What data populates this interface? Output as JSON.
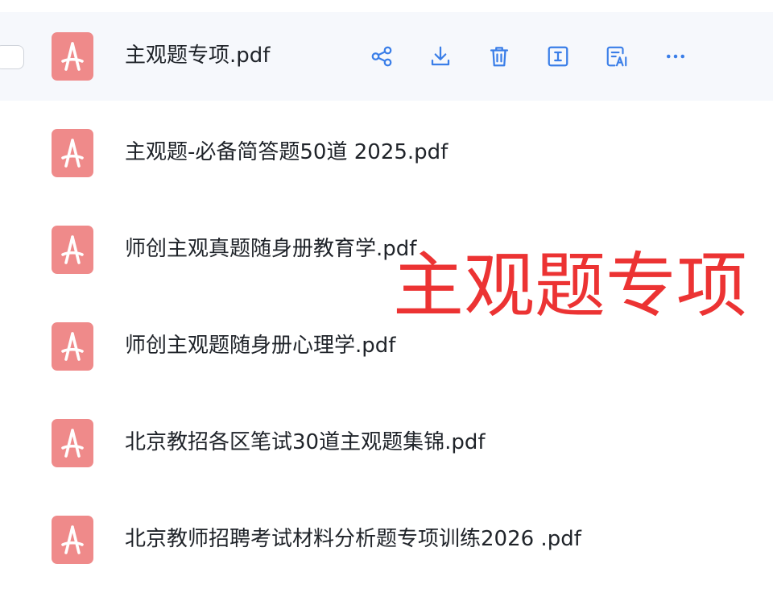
{
  "files": [
    {
      "name": "主观题专项.pdf"
    },
    {
      "name": "主观题-必备简答题50道 2025.pdf"
    },
    {
      "name": "师创主观真题随身册教育学.pdf"
    },
    {
      "name": "师创主观题随身册心理学.pdf"
    },
    {
      "name": "北京教招各区笔试30道主观题集锦.pdf"
    },
    {
      "name": "北京教师招聘考试材料分析题专项训练2026 .pdf"
    }
  ],
  "row_actions": [
    "share-icon",
    "download-icon",
    "delete-icon",
    "rename-icon",
    "ai-summary-icon",
    "more-icon"
  ],
  "overlay": {
    "text": "主观题专项"
  },
  "colors": {
    "pdf_icon": "#ef8a8a",
    "action_icon": "#3a7ee8",
    "overlay_text": "#ec3333",
    "selected_row_bg": "#f6f8fc"
  }
}
